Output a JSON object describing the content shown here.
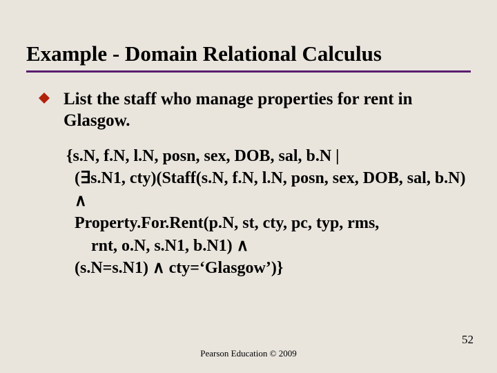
{
  "title": "Example - Domain Relational Calculus",
  "bullet": {
    "text": "List the staff who manage properties for rent in Glasgow."
  },
  "formula": {
    "line1": "{s.N, f.N, l.N, posn, sex, DOB, sal, b.N |",
    "line2": " (∃s.N1, cty)(Staff(s.N, f.N, l.N, posn, sex, DOB, sal, b.N) ∧",
    "line3": " Property.For.Rent(p.N, st, cty, pc, typ, rms,",
    "line4": "rnt, o.N, s.N1, b.N1) ∧",
    "line5": " (s.N=s.N1) ∧ cty=‘Glasgow’)}"
  },
  "footer": "Pearson Education © 2009",
  "page_number": "52"
}
